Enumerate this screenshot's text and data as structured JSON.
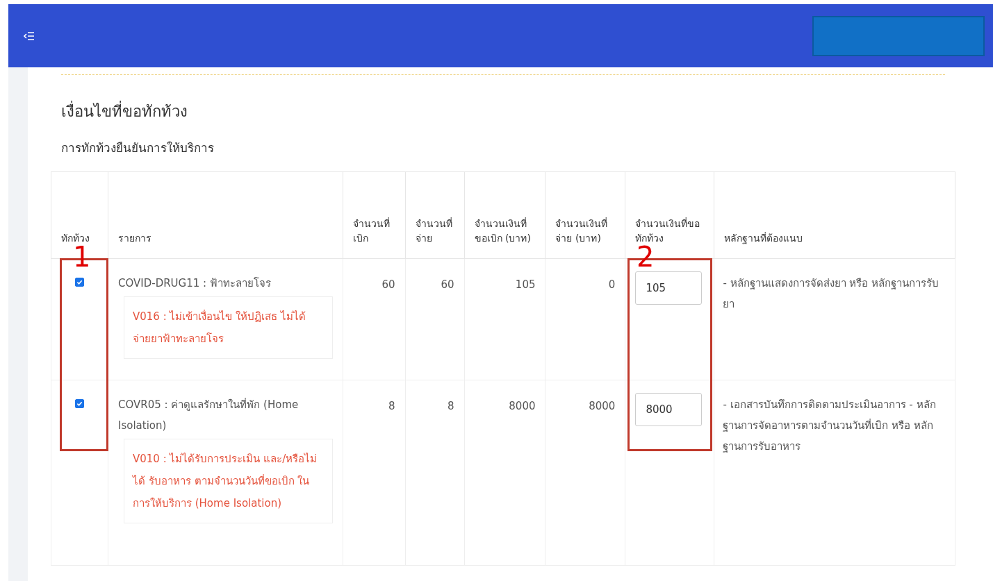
{
  "section": {
    "title": "เงื่อนไขที่ขอทักท้วง",
    "subtitle": "การทักท้วงยืนยันการให้บริการ"
  },
  "table": {
    "columns": [
      "ทักท้วง",
      "รายการ",
      "จำนวนที่เบิก",
      "จำนวนที่จ่าย",
      "จำนวนเงินที่ขอเบิก (บาท)",
      "จำนวนเงินที่จ่าย (บาท)",
      "จำนวนเงินที่ขอทักท้วง",
      "หลักฐานที่ต้องแนบ"
    ],
    "rows": [
      {
        "checked": true,
        "item": "COVID-DRUG11 : ฟ้าทะลายโจร",
        "warning": "V016 : ไม่เข้าเงื่อนไข ให้ปฏิเสธ ไม่ได้จ่ายยาฟ้าทะลายโจร",
        "qty_claimed": "60",
        "qty_paid": "60",
        "amount_claimed": "105",
        "amount_paid": "0",
        "claim_amount": "105",
        "evidence": "- หลักฐานแสดงการจัดส่งยา หรือ หลักฐานการรับยา"
      },
      {
        "checked": true,
        "item": "COVR05 : ค่าดูแลรักษาในที่พัก (Home Isolation)",
        "warning": "V010 : ไม่ได้รับการประเมิน และ/หรือไม่ได้ รับอาหาร ตามจำนวนวันที่ขอเบิก ในการให้บริการ (Home Isolation)",
        "qty_claimed": "8",
        "qty_paid": "8",
        "amount_claimed": "8000",
        "amount_paid": "8000",
        "claim_amount": "8000",
        "evidence": "- เอกสารบันทึกการติดตามประเมินอาการ - หลักฐานการจัดอาหารตามจำนวนวันที่เบิก หรือ หลักฐานการรับอาหาร"
      }
    ]
  },
  "annotations": [
    {
      "kind": "checkbox-column",
      "label": "1"
    },
    {
      "kind": "claim-column",
      "label": "2"
    }
  ]
}
